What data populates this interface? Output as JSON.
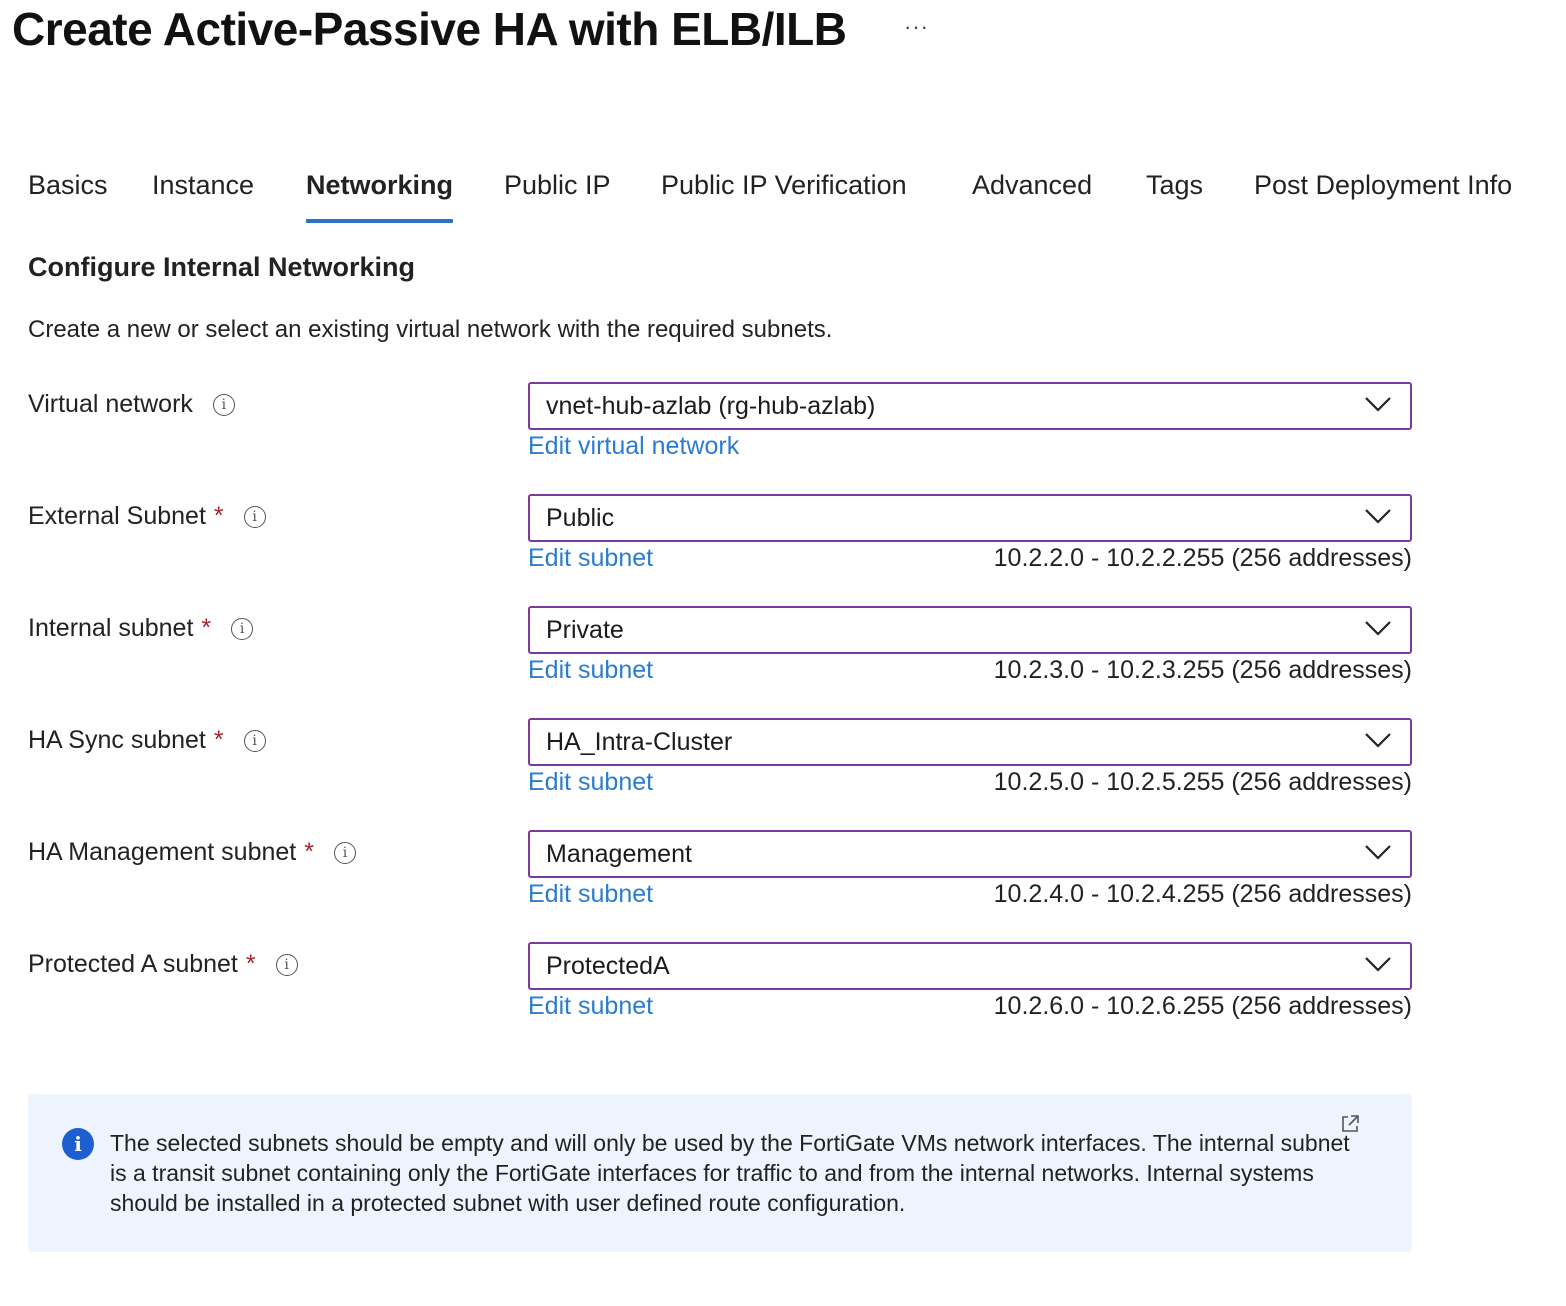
{
  "header": {
    "title": "Create Active-Passive HA with ELB/ILB",
    "more_label": "···"
  },
  "tabs": [
    {
      "label": "Basics"
    },
    {
      "label": "Instance"
    },
    {
      "label": "Networking",
      "active": true
    },
    {
      "label": "Public IP"
    },
    {
      "label": "Public IP Verification"
    },
    {
      "label": "Advanced"
    },
    {
      "label": "Tags"
    },
    {
      "label": "Post Deployment Info"
    }
  ],
  "section": {
    "title": "Configure Internal Networking",
    "description": "Create a new or select an existing virtual network with the required subnets."
  },
  "fields": [
    {
      "label": "Virtual network",
      "required": false,
      "value": "vnet-hub-azlab (rg-hub-azlab)",
      "link": "Edit virtual network",
      "range": ""
    },
    {
      "label": "External Subnet",
      "required": true,
      "value": "Public",
      "link": "Edit subnet",
      "range": "10.2.2.0 - 10.2.2.255 (256 addresses)"
    },
    {
      "label": "Internal subnet",
      "required": true,
      "value": "Private",
      "link": "Edit subnet",
      "range": "10.2.3.0 - 10.2.3.255 (256 addresses)"
    },
    {
      "label": "HA Sync subnet",
      "required": true,
      "value": "HA_Intra-Cluster",
      "link": "Edit subnet",
      "range": "10.2.5.0 - 10.2.5.255 (256 addresses)"
    },
    {
      "label": "HA Management subnet",
      "required": true,
      "value": "Management",
      "link": "Edit subnet",
      "range": "10.2.4.0 - 10.2.4.255 (256 addresses)"
    },
    {
      "label": "Protected A subnet",
      "required": true,
      "value": "ProtectedA",
      "link": "Edit subnet",
      "range": "10.2.6.0 - 10.2.6.255 (256 addresses)"
    }
  ],
  "required_marker": "*",
  "info_glyph": "i",
  "info_box": {
    "text": "The selected subnets should be empty and will only be used by the FortiGate VMs network interfaces. The internal subnet is a transit subnet containing only the FortiGate interfaces for traffic to and from the internal networks. Internal systems should be installed in a protected subnet with user defined route configuration."
  },
  "colors": {
    "accent": "#2b72c7",
    "link": "#2b7bd3",
    "select_border": "#7d3a9e",
    "required": "#a4262c",
    "info_bg": "#eef4fd",
    "info_icon": "#1f5ed1"
  }
}
